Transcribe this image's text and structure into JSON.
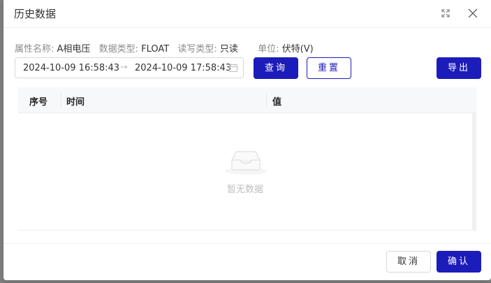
{
  "dialog": {
    "title": "历史数据",
    "fullscreen_icon": "fullscreen-icon",
    "close_icon": "close-icon"
  },
  "meta": {
    "property_key": "属性名称:",
    "property_value": "A相电压",
    "datatype_key": "数据类型:",
    "datatype_value": "FLOAT",
    "rw_key": "读写类型:",
    "rw_value": "只读",
    "unit_key": "单位:",
    "unit_value": "伏特(V)"
  },
  "range": {
    "start": "2024-10-09 16:58:43",
    "separator": "→",
    "end": "2024-10-09 17:58:43",
    "icon": "calendar-icon"
  },
  "toolbar": {
    "query_label": "查询",
    "reset_label": "重置",
    "export_label": "导出"
  },
  "table": {
    "columns": [
      "序号",
      "时间",
      "值"
    ],
    "rows": [],
    "empty_text": "暂无数据",
    "empty_icon": "inbox-empty-icon"
  },
  "footer": {
    "cancel_label": "取消",
    "ok_label": "确认"
  },
  "colors": {
    "primary": "#1c1cbb",
    "backdrop": "#808080"
  }
}
